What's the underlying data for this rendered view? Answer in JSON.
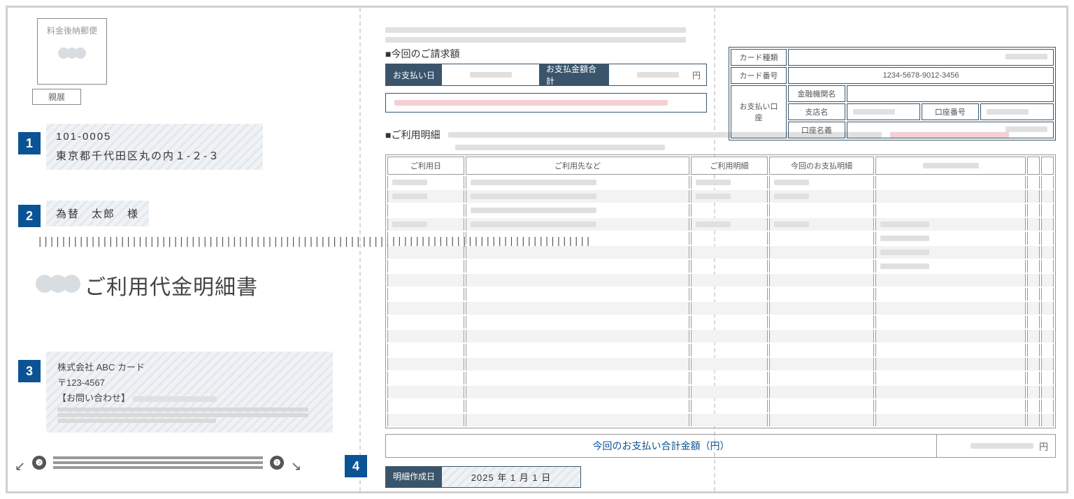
{
  "postage": {
    "label": "料金後納郵便",
    "confidential": "親展"
  },
  "markers": {
    "m1": "1",
    "m2": "2",
    "m3": "3",
    "m4": "4",
    "c1": "❶",
    "c2": "❷"
  },
  "address": {
    "postal": "101-0005",
    "line": "東京都千代田区丸の内１-２-３"
  },
  "recipient": {
    "name": "為替　太郎　様"
  },
  "barcode": "||||||||||||||||||||||||||||||||||||||||||||||||||||||||||||||||||||||||||||||||||||||||||||||",
  "doc_title": "ご利用代金明細書",
  "company": {
    "name": "株式会社 ABC カード",
    "postal": "〒123-4567",
    "contact_label": "【お問い合わせ】"
  },
  "bill": {
    "section": "■今回のご請求額",
    "pay_date_label": "お支払い日",
    "pay_total_label": "お支払金額合計",
    "yen": "円"
  },
  "card": {
    "type_label": "カード種類",
    "number_label": "カード番号",
    "number_value": "1234-5678-9012-3456",
    "account_label": "お支払い口座",
    "bank_label": "金融機関名",
    "branch_label": "支店名",
    "acct_no_label": "口座番号",
    "holder_label": "口座名義"
  },
  "detail": {
    "section": "■ご利用明細",
    "headers": {
      "date": "ご利用日",
      "merchant": "ご利用先など",
      "usage": "ご利用明細",
      "this_pay": "今回のお支払明細"
    }
  },
  "total": {
    "label": "今回のお支払い合計金額（円）",
    "yen": "円"
  },
  "created": {
    "label": "明細作成日",
    "value": "2025 年 1 月 1 日"
  }
}
